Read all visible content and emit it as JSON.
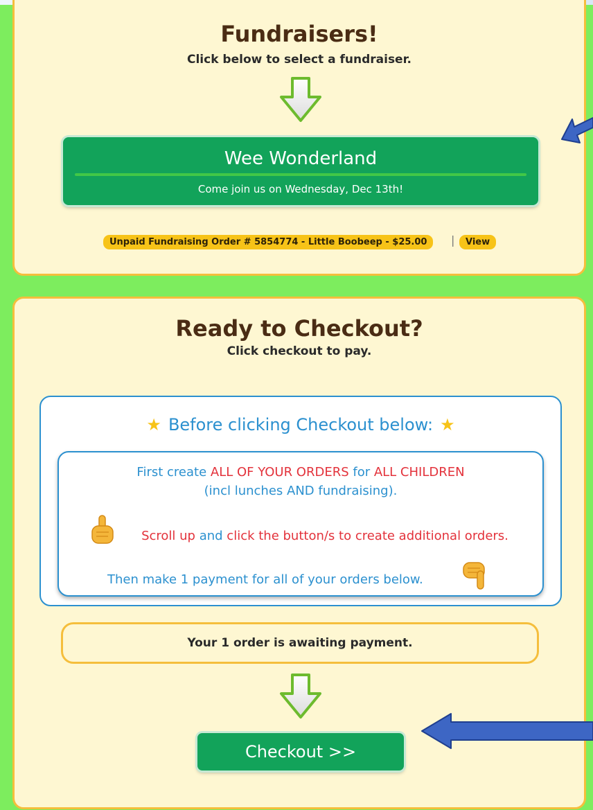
{
  "fundraisers": {
    "title": "Fundraisers!",
    "subtitle": "Click below to select a fundraiser.",
    "event": {
      "title": "Wee Wonderland",
      "subtitle": "Come join us on Wednesday, Dec 13th!"
    },
    "unpaid_order_label": "Unpaid Fundraising Order # 5854774 - Little Boobeep - $25.00",
    "separator": "|",
    "view_label": "View"
  },
  "checkout": {
    "title": "Ready to Checkout?",
    "subtitle": "Click checkout to pay.",
    "info": {
      "title": "Before clicking Checkout below:",
      "line1_a": "First create ",
      "line1_b": "ALL OF YOUR ORDERS",
      "line1_c": " for ",
      "line1_d": "ALL CHILDREN",
      "line2": "(incl lunches AND fundraising).",
      "line3_a": "Scroll up ",
      "line3_b": "and ",
      "line3_c": "click the button/s to create additional orders.",
      "line4": "Then make 1 payment for all of your orders below."
    },
    "awaiting_text": "Your 1 order is awaiting payment.",
    "button_label": "Checkout >>"
  },
  "colors": {
    "background": "#7ded5e",
    "panel": "#fef7d2",
    "panel_border": "#f5be3c",
    "button_green": "#12a35a",
    "info_blue": "#2b90cf",
    "emphasis_red": "#e3323b",
    "badge_yellow": "#f7c318",
    "annotation_arrow": "#3d66c4"
  },
  "icons": [
    "down-arrow-icon",
    "star-icon",
    "pointing-up-hand-icon",
    "pointing-down-hand-icon",
    "annotation-arrow-icon"
  ]
}
